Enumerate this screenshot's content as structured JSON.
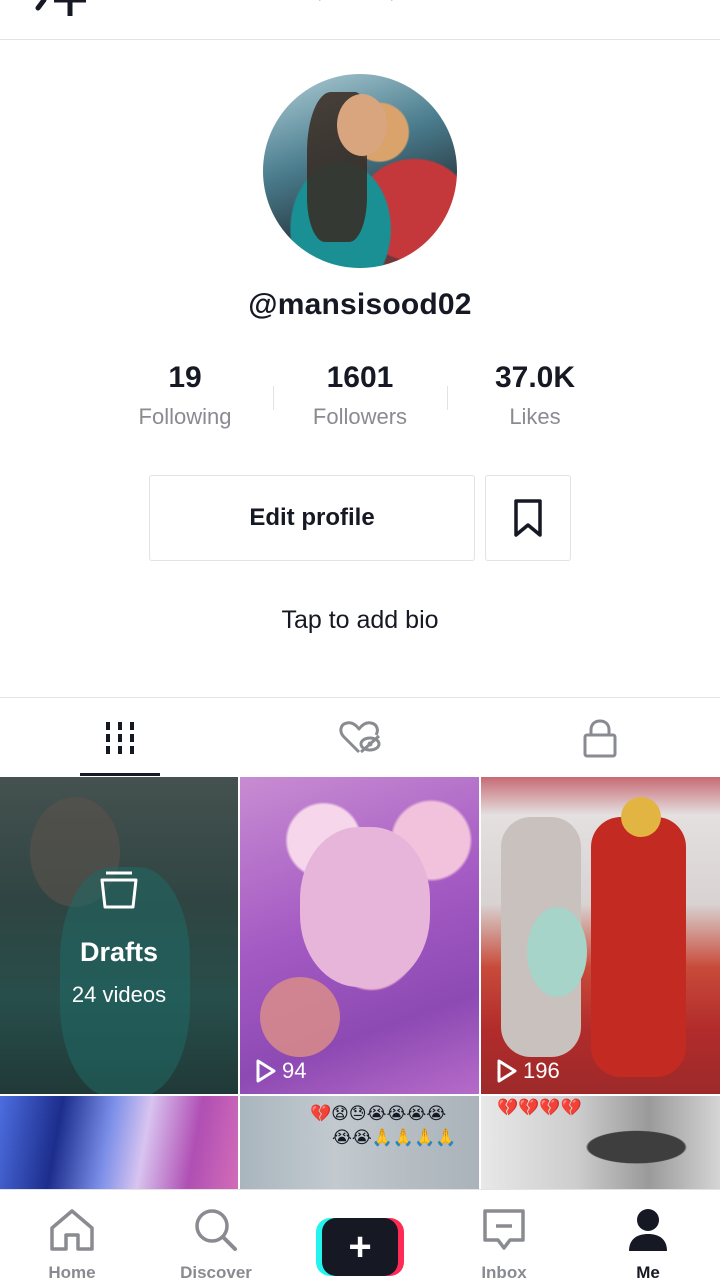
{
  "profile": {
    "username": "@mansisood02",
    "bio_placeholder": "Tap to add bio"
  },
  "stats": [
    {
      "value": "19",
      "label": "Following"
    },
    {
      "value": "1601",
      "label": "Followers"
    },
    {
      "value": "37.0K",
      "label": "Likes"
    }
  ],
  "actions": {
    "edit_profile": "Edit profile"
  },
  "tabs": [
    {
      "icon": "grid-icon",
      "active": true
    },
    {
      "icon": "liked-hidden-icon",
      "active": false
    },
    {
      "icon": "lock-icon",
      "active": false
    }
  ],
  "grid": {
    "drafts": {
      "title": "Drafts",
      "count": "24 videos"
    },
    "videos": [
      {
        "views": "94"
      },
      {
        "views": "196"
      }
    ],
    "row2_emojis_a": "💔😧😓😭😭😭😭",
    "row2_emojis_b": "😭😭🙏🙏🙏🙏",
    "row2_emojis_c": "💔💔💔💔"
  },
  "nav": {
    "home": "Home",
    "discover": "Discover",
    "create": "+",
    "inbox": "Inbox",
    "me": "Me"
  },
  "colors": {
    "accent_red": "#fe2c55",
    "accent_cyan": "#25f4ee",
    "text_primary": "#161823",
    "text_secondary": "#8a8b91"
  }
}
